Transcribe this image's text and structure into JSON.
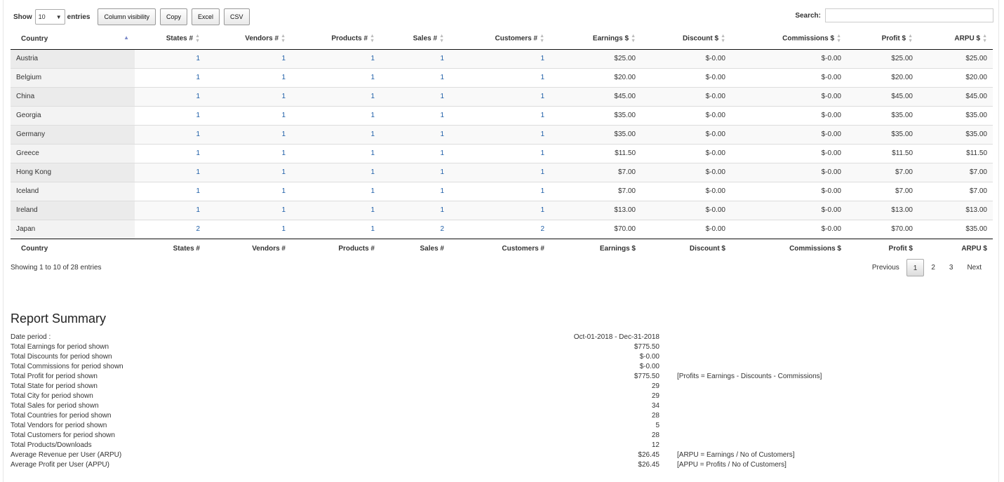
{
  "toolbar": {
    "show_label": "Show",
    "entries_label": "entries",
    "page_length": "10",
    "buttons": [
      "Column visibility",
      "Copy",
      "Excel",
      "CSV"
    ]
  },
  "search": {
    "label": "Search:",
    "value": ""
  },
  "columns": [
    "Country",
    "States #",
    "Vendors #",
    "Products #",
    "Sales #",
    "Customers #",
    "Earnings $",
    "Discount $",
    "Commissions $",
    "Profit $",
    "ARPU $"
  ],
  "rows": [
    [
      "Austria",
      "1",
      "1",
      "1",
      "1",
      "1",
      "$25.00",
      "$-0.00",
      "$-0.00",
      "$25.00",
      "$25.00"
    ],
    [
      "Belgium",
      "1",
      "1",
      "1",
      "1",
      "1",
      "$20.00",
      "$-0.00",
      "$-0.00",
      "$20.00",
      "$20.00"
    ],
    [
      "China",
      "1",
      "1",
      "1",
      "1",
      "1",
      "$45.00",
      "$-0.00",
      "$-0.00",
      "$45.00",
      "$45.00"
    ],
    [
      "Georgia",
      "1",
      "1",
      "1",
      "1",
      "1",
      "$35.00",
      "$-0.00",
      "$-0.00",
      "$35.00",
      "$35.00"
    ],
    [
      "Germany",
      "1",
      "1",
      "1",
      "1",
      "1",
      "$35.00",
      "$-0.00",
      "$-0.00",
      "$35.00",
      "$35.00"
    ],
    [
      "Greece",
      "1",
      "1",
      "1",
      "1",
      "1",
      "$11.50",
      "$-0.00",
      "$-0.00",
      "$11.50",
      "$11.50"
    ],
    [
      "Hong Kong",
      "1",
      "1",
      "1",
      "1",
      "1",
      "$7.00",
      "$-0.00",
      "$-0.00",
      "$7.00",
      "$7.00"
    ],
    [
      "Iceland",
      "1",
      "1",
      "1",
      "1",
      "1",
      "$7.00",
      "$-0.00",
      "$-0.00",
      "$7.00",
      "$7.00"
    ],
    [
      "Ireland",
      "1",
      "1",
      "1",
      "1",
      "1",
      "$13.00",
      "$-0.00",
      "$-0.00",
      "$13.00",
      "$13.00"
    ],
    [
      "Japan",
      "2",
      "1",
      "1",
      "2",
      "2",
      "$70.00",
      "$-0.00",
      "$-0.00",
      "$70.00",
      "$35.00"
    ]
  ],
  "info": "Showing 1 to 10 of 28 entries",
  "pager": {
    "previous": "Previous",
    "pages": [
      "1",
      "2",
      "3"
    ],
    "current": "1",
    "next": "Next"
  },
  "summary": {
    "title": "Report Summary",
    "items": [
      {
        "label": "Date period :",
        "value": "Oct-01-2018 - Dec-31-2018",
        "note": ""
      },
      {
        "label": "Total Earnings for period shown",
        "value": "$775.50",
        "note": ""
      },
      {
        "label": "Total Discounts for period shown",
        "value": "$-0.00",
        "note": ""
      },
      {
        "label": "Total Commissions for period shown",
        "value": "$-0.00",
        "note": ""
      },
      {
        "label": "Total Profit for period shown",
        "value": "$775.50",
        "note": "[Profits = Earnings - Discounts - Commissions]"
      },
      {
        "label": "Total State for period shown",
        "value": "29",
        "note": ""
      },
      {
        "label": "Total City for period shown",
        "value": "29",
        "note": ""
      },
      {
        "label": "Total Sales for period shown",
        "value": "34",
        "note": ""
      },
      {
        "label": "Total Countries for period shown",
        "value": "28",
        "note": ""
      },
      {
        "label": "Total Vendors for period shown",
        "value": "5",
        "note": ""
      },
      {
        "label": "Total Customers for period shown",
        "value": "28",
        "note": ""
      },
      {
        "label": "Total Products/Downloads",
        "value": "12",
        "note": ""
      },
      {
        "label": "Average Revenue per User (ARPU)",
        "value": "$26.45",
        "note": "[ARPU = Earnings / No of Customers]"
      },
      {
        "label": "Average Profit per User (APPU)",
        "value": "$26.45",
        "note": "[APPU = Profits / No of Customers]"
      }
    ]
  }
}
